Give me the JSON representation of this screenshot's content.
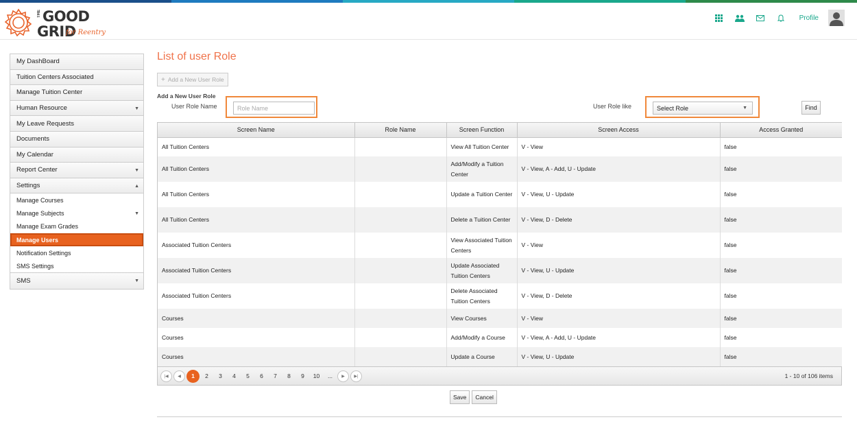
{
  "header": {
    "logo": {
      "the": "THE",
      "line1": "GOOD",
      "line2": "GRID",
      "tagline": "for Reentry"
    },
    "nav_icons": [
      "apps-grid-icon",
      "users-icon",
      "mail-icon",
      "bell-icon"
    ],
    "profile_label": "Profile",
    "stripe_colors": [
      "#1a4f8a",
      "#1f7bbf",
      "#27a9c4",
      "#1aa88c",
      "#2e8a4a"
    ]
  },
  "sidebar": {
    "items": [
      {
        "label": "My DashBoard"
      },
      {
        "label": "Tuition Centers Associated"
      },
      {
        "label": "Manage Tuition Center"
      },
      {
        "label": "Human Resource",
        "caret": "▼"
      },
      {
        "label": "My Leave Requests"
      },
      {
        "label": "Documents"
      },
      {
        "label": "My Calendar"
      },
      {
        "label": "Report Center",
        "caret": "▼"
      },
      {
        "label": "Settings",
        "caret": "▲"
      }
    ],
    "settings_sub": [
      {
        "label": "Manage Courses"
      },
      {
        "label": "Manage Subjects",
        "caret": "▼"
      },
      {
        "label": "Manage Exam Grades"
      },
      {
        "label": "Manage Users",
        "active": true
      },
      {
        "label": "Notification Settings"
      },
      {
        "label": "SMS Settings"
      }
    ],
    "sms": {
      "label": "SMS",
      "caret": "▼"
    }
  },
  "main": {
    "title": "List of user Role",
    "add_button": "Add a New User Role",
    "add_heading": "Add a New User Role",
    "role_name_label": "User Role Name",
    "role_name_placeholder": "Role Name",
    "role_like_label": "User Role like",
    "role_select_value": "Select Role",
    "find_button": "Find",
    "accent_color": "#f0724a"
  },
  "grid": {
    "columns": [
      "Screen Name",
      "Role Name",
      "Screen Function",
      "Screen Access",
      "Access Granted"
    ],
    "rows": [
      {
        "screen": "All Tuition Centers",
        "role": "",
        "function": "View All Tuition Center",
        "access": "V - View",
        "granted": "false"
      },
      {
        "screen": "All Tuition Centers",
        "role": "",
        "function": "Add/Modify a Tuition Center",
        "access": "V - View, A - Add, U - Update",
        "granted": "false"
      },
      {
        "screen": "All Tuition Centers",
        "role": "",
        "function": "Update a Tuition Center",
        "access": "V - View, U - Update",
        "granted": "false"
      },
      {
        "screen": "All Tuition Centers",
        "role": "",
        "function": "Delete a Tuition Center",
        "access": "V - View, D - Delete",
        "granted": "false"
      },
      {
        "screen": "Associated Tuition Centers",
        "role": "",
        "function": "View Associated Tuition Centers",
        "access": "V - View",
        "granted": "false"
      },
      {
        "screen": "Associated Tuition Centers",
        "role": "",
        "function": "Update Associated Tuition Centers",
        "access": "V - View, U - Update",
        "granted": "false"
      },
      {
        "screen": "Associated Tuition Centers",
        "role": "",
        "function": "Delete Associated Tuition Centers",
        "access": "V - View, D - Delete",
        "granted": "false"
      },
      {
        "screen": "Courses",
        "role": "",
        "function": "View Courses",
        "access": "V - View",
        "granted": "false"
      },
      {
        "screen": "Courses",
        "role": "",
        "function": "Add/Modify a Course",
        "access": "V - View, A - Add, U - Update",
        "granted": "false"
      },
      {
        "screen": "Courses",
        "role": "",
        "function": "Update a Course",
        "access": "V - View, U - Update",
        "granted": "false"
      }
    ],
    "pager": {
      "pages": [
        "1",
        "2",
        "3",
        "4",
        "5",
        "6",
        "7",
        "8",
        "9",
        "10",
        "..."
      ],
      "current": "1",
      "info": "1 - 10 of 106 items"
    }
  },
  "actions": {
    "save": "Save",
    "cancel": "Cancel"
  }
}
